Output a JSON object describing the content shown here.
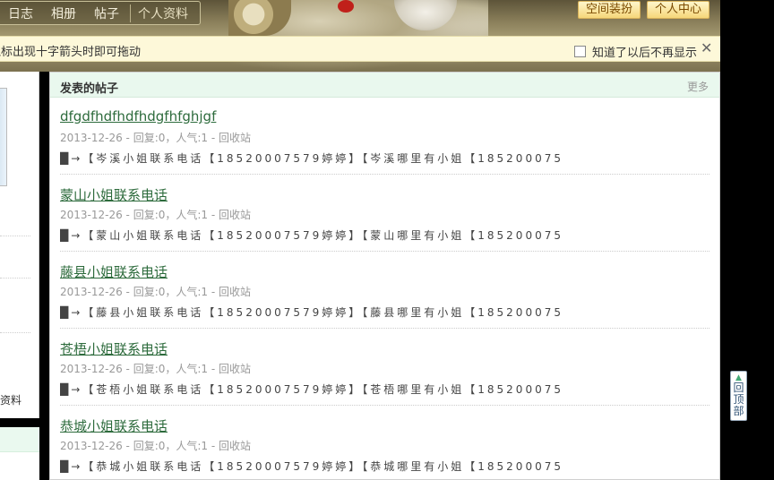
{
  "nav": {
    "items": [
      {
        "label": "日志"
      },
      {
        "label": "相册"
      },
      {
        "label": "帖子"
      },
      {
        "label": "个人资料"
      }
    ]
  },
  "header_buttons": {
    "decorate": "空间装扮",
    "personal_center": "个人中心"
  },
  "tipbar": {
    "text": "鼠标出现十字箭头时即可拖动",
    "dismiss_label": "知道了以后不再显示",
    "close": "✕"
  },
  "sidebar": {
    "more_info": "多资料"
  },
  "main": {
    "title": "发表的帖子",
    "more": "更多",
    "posts": [
      {
        "title": "dfgdfhdfhdfhdgfhfghjgf",
        "meta": "2013-12-26 - 回复:0，人气:1 - 回收站",
        "snippet": "█→【岑溪小姐联系电话【18520007579婷婷】【岑溪哪里有小姐【185200075"
      },
      {
        "title": "蒙山小姐联系电话",
        "meta": "2013-12-26 - 回复:0，人气:1 - 回收站",
        "snippet": "█→【蒙山小姐联系电话【18520007579婷婷】【蒙山哪里有小姐【185200075"
      },
      {
        "title": "藤县小姐联系电话",
        "meta": "2013-12-26 - 回复:0，人气:1 - 回收站",
        "snippet": "█→【藤县小姐联系电话【18520007579婷婷】【藤县哪里有小姐【185200075"
      },
      {
        "title": "苍梧小姐联系电话",
        "meta": "2013-12-26 - 回复:0，人气:1 - 回收站",
        "snippet": "█→【苍梧小姐联系电话【18520007579婷婷】【苍梧哪里有小姐【185200075"
      },
      {
        "title": "恭城小姐联系电话",
        "meta": "2013-12-26 - 回复:0，人气:1 - 回收站",
        "snippet": "█→【恭城小姐联系电话【18520007579婷婷】【恭城哪里有小姐【185200075"
      }
    ]
  },
  "back_to_top": {
    "arrow": "▲",
    "label": "回顶部"
  }
}
